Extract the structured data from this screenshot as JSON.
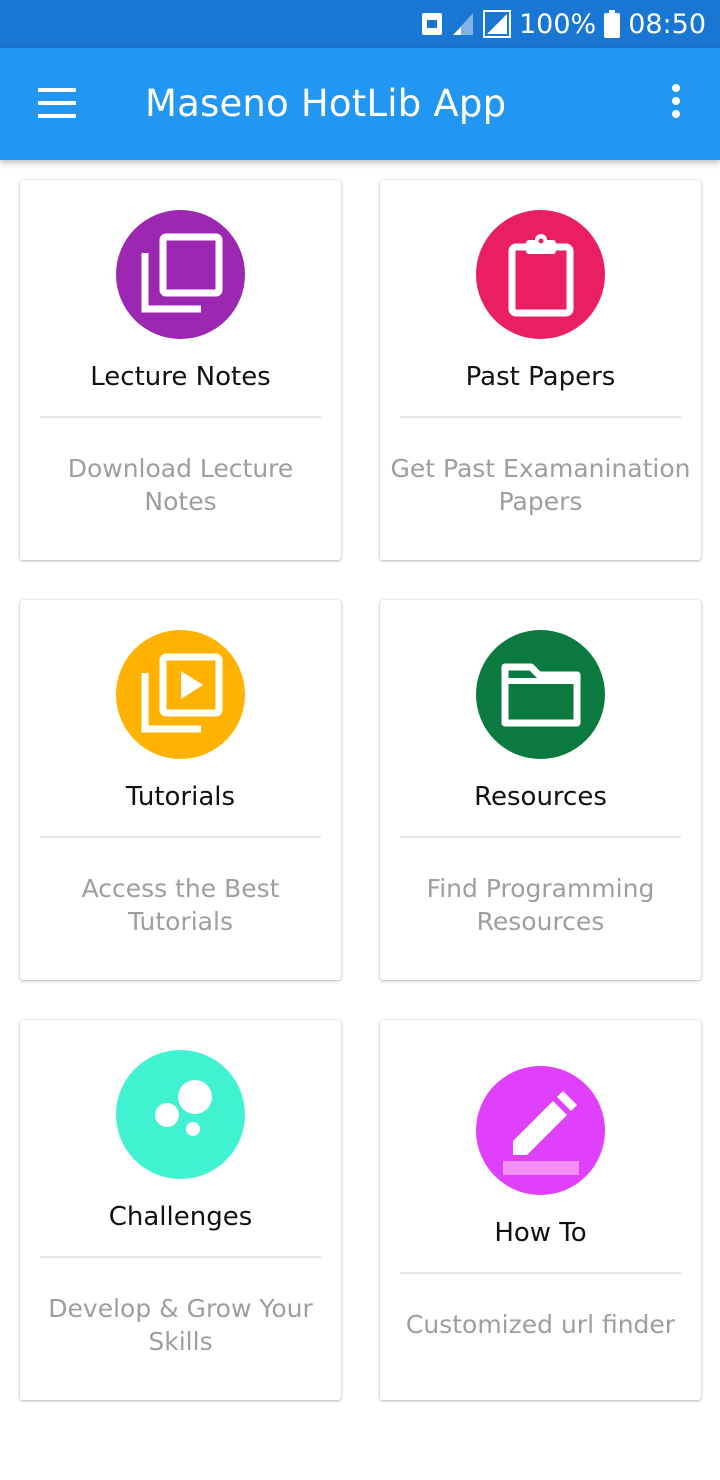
{
  "status_bar": {
    "battery": "100%",
    "time": "08:50",
    "icons": [
      "notification-icon",
      "signal-icon",
      "signal-icon",
      "battery-icon"
    ]
  },
  "app_bar": {
    "title": "Maseno HotLib App",
    "icons": [
      "menu-icon",
      "overflow-menu-icon"
    ]
  },
  "cards": [
    {
      "title": "Lecture Notes",
      "description": "Download Lecture Notes",
      "icon": "library-books-icon",
      "color": "#9c27b0"
    },
    {
      "title": "Past Papers",
      "description": "Get Past Examanination Papers",
      "icon": "clipboard-icon",
      "color": "#e91e63"
    },
    {
      "title": "Tutorials",
      "description": "Access the Best Tutorials",
      "icon": "video-library-icon",
      "color": "#ffb300"
    },
    {
      "title": "Resources",
      "description": "Find Programming Resources",
      "icon": "folder-icon",
      "color": "#0b7a3e"
    },
    {
      "title": "Challenges",
      "description": "Develop & Grow Your Skills",
      "icon": "bubbles-icon",
      "color": "#40f2d0"
    },
    {
      "title": "How To",
      "description": "Customized url finder",
      "icon": "edit-pencil-icon",
      "color": "#e040fb"
    }
  ]
}
